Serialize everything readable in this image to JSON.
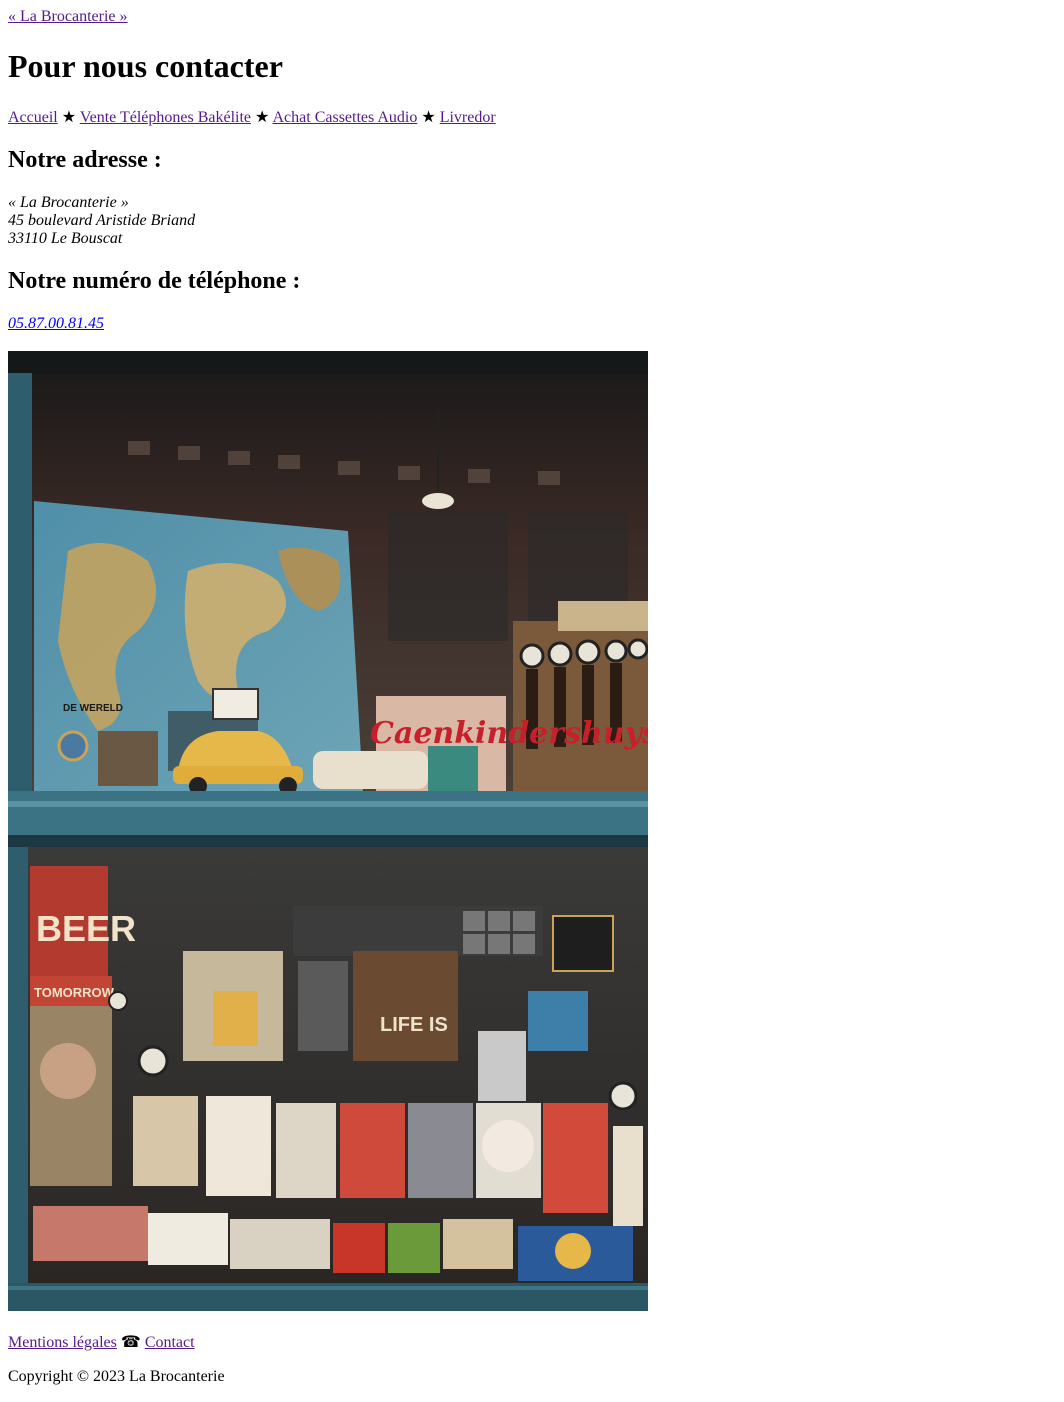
{
  "header": {
    "home_link": "« La Brocanterie »",
    "title": "Pour nous contacter"
  },
  "nav": {
    "separator": "★",
    "items": [
      "Accueil",
      "Vente Téléphones Bakélite",
      "Achat Cassettes Audio",
      "Livredor"
    ]
  },
  "address": {
    "heading": "Notre adresse :",
    "line1": "« La Brocanterie »",
    "line2": "45 boulevard Aristide Briand",
    "line3": "33110 Le Bouscat"
  },
  "phone": {
    "heading": "Notre numéro de téléphone :",
    "number": "05.87.00.81.45"
  },
  "photo": {
    "sign_text": "Caenkindershuys",
    "map_label": "DE WERELD",
    "beer_sign": "BEER",
    "tomorrow_sign": "TOMORROW",
    "life_sign": "LIFE IS"
  },
  "footer": {
    "legal_link": "Mentions légales",
    "phone_glyph": "☎",
    "contact_link": "Contact",
    "copyright": "Copyright © 2023 La Brocanterie"
  },
  "colors": {
    "visited_link": "#551a8b",
    "link": "#0000ee",
    "window_frame": "#2f6272"
  }
}
